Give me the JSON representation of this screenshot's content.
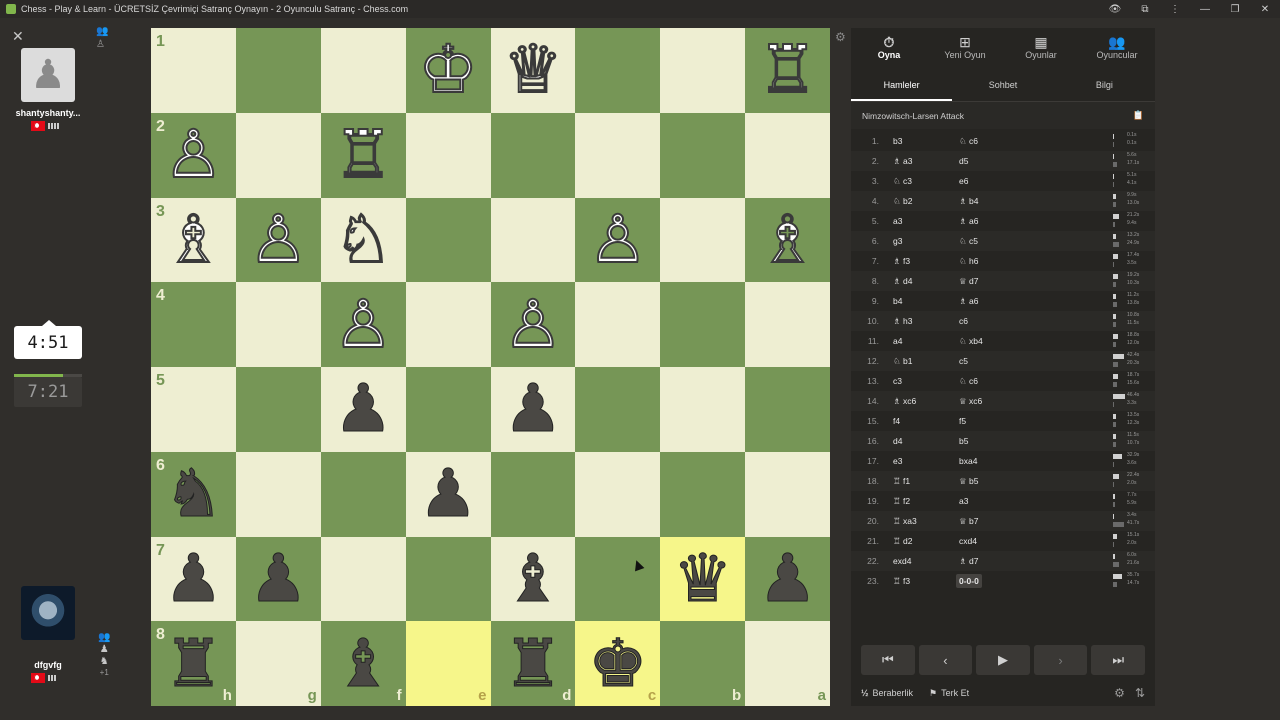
{
  "window": {
    "title": "Chess - Play & Learn - ÜCRETSİZ Çevrimiçi Satranç Oynayın - 2 Oyunculu Satranç - Chess.com",
    "controls": [
      "👁",
      "⧉",
      "⋮",
      "—",
      "❐",
      "✕"
    ]
  },
  "left": {
    "close_glyph": "✕",
    "top_icons": [
      "👥",
      "♙"
    ],
    "opponent": {
      "name": "shantyshanty...",
      "avatar_glyph": "♟"
    },
    "clocks": {
      "active": "4:51",
      "idle": "7:21",
      "active_progress": 0.72
    },
    "player": {
      "name": "dfgvfg"
    },
    "bottom_icons": [
      "👥",
      "♟",
      "♞",
      "+1"
    ]
  },
  "board": {
    "ranks": [
      "1",
      "2",
      "3",
      "4",
      "5",
      "6",
      "7",
      "8"
    ],
    "files": [
      "h",
      "g",
      "f",
      "e",
      "d",
      "c",
      "b",
      "a"
    ],
    "highlight_squares": [
      [
        6,
        6
      ],
      [
        7,
        3
      ],
      [
        7,
        5
      ]
    ],
    "pieces": [
      [
        "",
        "",
        "",
        "♔w",
        "♕w",
        "",
        "",
        "♖w"
      ],
      [
        "♙w",
        "",
        "♖w",
        "",
        "",
        "",
        "",
        ""
      ],
      [
        "♗w",
        "♙w",
        "♘w",
        "",
        "",
        "♙w",
        "",
        "♗w"
      ],
      [
        "",
        "",
        "♙w",
        "",
        "♙w",
        "",
        "",
        ""
      ],
      [
        "",
        "",
        "♟b",
        "",
        "♟b",
        "",
        "",
        ""
      ],
      [
        "♞b",
        "",
        "",
        "♟b",
        "",
        "",
        "",
        ""
      ],
      [
        "♟b",
        "♟b",
        "",
        "",
        "♝b",
        "",
        "♛b",
        "♟b"
      ],
      [
        "♜b",
        "",
        "♝b",
        "",
        "♜b",
        "♚b",
        "",
        ""
      ]
    ],
    "settings_glyph": "⚙"
  },
  "panel": {
    "nav": [
      {
        "icon": "⏱",
        "label": "Oyna",
        "active": true
      },
      {
        "icon": "⊞",
        "label": "Yeni Oyun"
      },
      {
        "icon": "▦",
        "label": "Oyunlar"
      },
      {
        "icon": "👥",
        "label": "Oyuncular"
      }
    ],
    "tabs": [
      {
        "label": "Hamleler",
        "active": true
      },
      {
        "label": "Sohbet"
      },
      {
        "label": "Bilgi"
      }
    ],
    "opening": "Nimzowitsch-Larsen Attack",
    "book_glyph": "📋",
    "moves": [
      {
        "n": "1.",
        "w": "b3",
        "b": "♘ c6",
        "wt": "0.1s",
        "bt": "0.1s",
        "wf": 0.02,
        "bf": 0.02
      },
      {
        "n": "2.",
        "w": "♗ a3",
        "b": "d5",
        "wt": "5.6s",
        "bt": "17.1s",
        "wf": 0.12,
        "bf": 0.37
      },
      {
        "n": "3.",
        "w": "♘ c3",
        "b": "e6",
        "wt": "5.1s",
        "bt": "4.1s",
        "wf": 0.11,
        "bf": 0.09
      },
      {
        "n": "4.",
        "w": "♘ b2",
        "b": "♗ b4",
        "wt": "9.9s",
        "bt": "13.0s",
        "wf": 0.21,
        "bf": 0.28
      },
      {
        "n": "5.",
        "w": "a3",
        "b": "♗ a6",
        "wt": "21.2s",
        "bt": "9.4s",
        "wf": 0.46,
        "bf": 0.2
      },
      {
        "n": "6.",
        "w": "g3",
        "b": "♘ c5",
        "wt": "13.2s",
        "bt": "24.9s",
        "wf": 0.29,
        "bf": 0.54
      },
      {
        "n": "7.",
        "w": "♗ f3",
        "b": "♘ h6",
        "wt": "17.4s",
        "bt": "3.5s",
        "wf": 0.38,
        "bf": 0.08
      },
      {
        "n": "8.",
        "w": "♗ d4",
        "b": "♕ d7",
        "wt": "19.2s",
        "bt": "10.3s",
        "wf": 0.42,
        "bf": 0.22
      },
      {
        "n": "9.",
        "w": "b4",
        "b": "♗ a6",
        "wt": "11.2s",
        "bt": "13.8s",
        "wf": 0.24,
        "bf": 0.3
      },
      {
        "n": "10.",
        "w": "♗ h3",
        "b": "c6",
        "wt": "10.8s",
        "bt": "11.5s",
        "wf": 0.23,
        "bf": 0.25
      },
      {
        "n": "11.",
        "w": "a4",
        "b": "♘ xb4",
        "wt": "18.8s",
        "bt": "12.0s",
        "wf": 0.41,
        "bf": 0.26
      },
      {
        "n": "12.",
        "w": "♘ b1",
        "b": "c5",
        "wt": "42.4s",
        "bt": "20.3s",
        "wf": 0.92,
        "bf": 0.44
      },
      {
        "n": "13.",
        "w": "c3",
        "b": "♘ c6",
        "wt": "18.7s",
        "bt": "15.6s",
        "wf": 0.4,
        "bf": 0.34
      },
      {
        "n": "14.",
        "w": "♗ xc6",
        "b": "♕ xc6",
        "wt": "46.4s",
        "bt": "3.3s",
        "wf": 1.0,
        "bf": 0.07
      },
      {
        "n": "15.",
        "w": "f4",
        "b": "f5",
        "wt": "13.5s",
        "bt": "12.3s",
        "wf": 0.29,
        "bf": 0.27
      },
      {
        "n": "16.",
        "w": "d4",
        "b": "b5",
        "wt": "11.5s",
        "bt": "10.7s",
        "wf": 0.25,
        "bf": 0.23
      },
      {
        "n": "17.",
        "w": "e3",
        "b": "bxa4",
        "wt": "32.9s",
        "bt": "3.6s",
        "wf": 0.71,
        "bf": 0.08
      },
      {
        "n": "18.",
        "w": "♖ f1",
        "b": "♕ b5",
        "wt": "22.4s",
        "bt": "2.0s",
        "wf": 0.48,
        "bf": 0.04
      },
      {
        "n": "19.",
        "w": "♖ f2",
        "b": "a3",
        "wt": "7.7s",
        "bt": "5.9s",
        "wf": 0.17,
        "bf": 0.13
      },
      {
        "n": "20.",
        "w": "♖ xa3",
        "b": "♕ b7",
        "wt": "3.4s",
        "bt": "41.7s",
        "wf": 0.07,
        "bf": 0.9
      },
      {
        "n": "21.",
        "w": "♖ d2",
        "b": "cxd4",
        "wt": "15.1s",
        "bt": "2.0s",
        "wf": 0.33,
        "bf": 0.04
      },
      {
        "n": "22.",
        "w": "exd4",
        "b": "♗ d7",
        "wt": "6.0s",
        "bt": "21.6s",
        "wf": 0.13,
        "bf": 0.47
      },
      {
        "n": "23.",
        "w": "♖ f3",
        "b": "0-0-0",
        "wt": "35.7s",
        "bt": "14.7s",
        "wf": 0.77,
        "bf": 0.32,
        "current": true
      }
    ],
    "controls": [
      "⏮",
      "‹",
      "▶",
      "›",
      "⏭"
    ],
    "footer": {
      "draw_icon": "½",
      "draw": "Beraberlik",
      "resign_icon": "⚑",
      "resign": "Terk Et",
      "icons": [
        "⚙",
        "⇅"
      ]
    }
  }
}
